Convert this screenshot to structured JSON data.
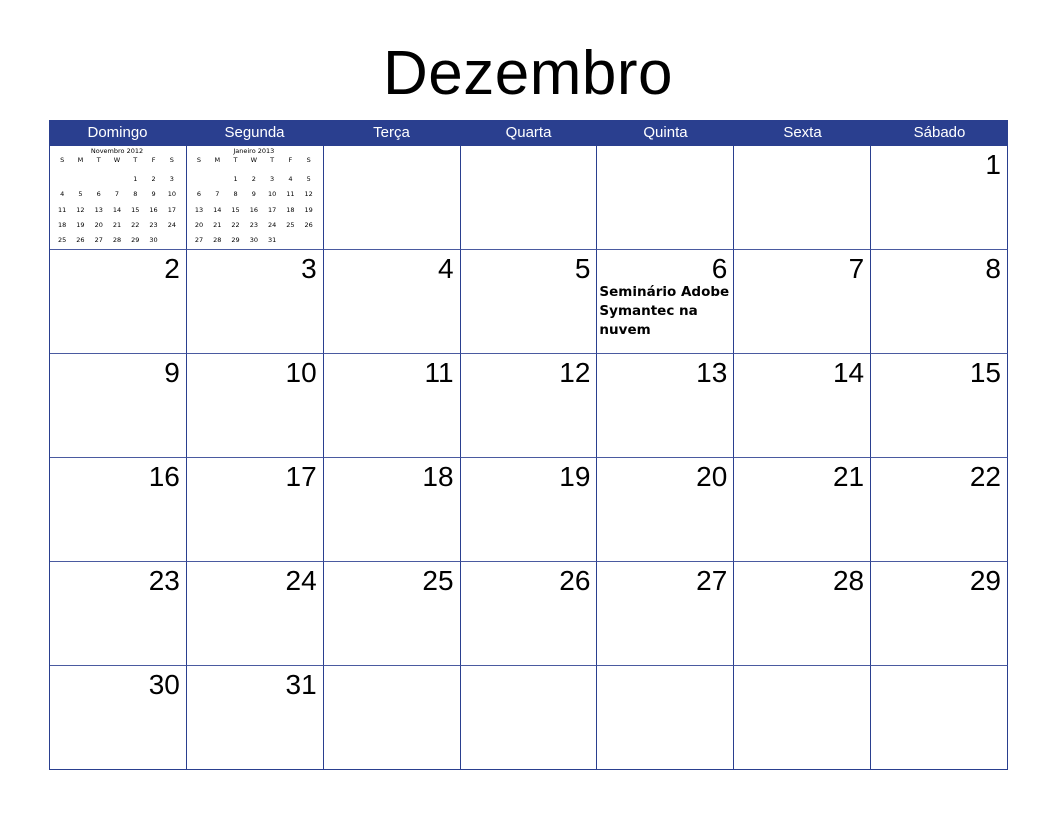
{
  "title": "Dezembro",
  "weekdays": [
    "Domingo",
    "Segunda",
    "Terça",
    "Quarta",
    "Quinta",
    "Sexta",
    "Sábado"
  ],
  "mini_calendars": [
    {
      "title": "Novembro 2012",
      "days_header": [
        "S",
        "M",
        "T",
        "W",
        "T",
        "F",
        "S"
      ],
      "weeks": [
        [
          "",
          "",
          "",
          "",
          "1",
          "2",
          "3"
        ],
        [
          "4",
          "5",
          "6",
          "7",
          "8",
          "9",
          "10"
        ],
        [
          "11",
          "12",
          "13",
          "14",
          "15",
          "16",
          "17"
        ],
        [
          "18",
          "19",
          "20",
          "21",
          "22",
          "23",
          "24"
        ],
        [
          "25",
          "26",
          "27",
          "28",
          "29",
          "30",
          ""
        ]
      ]
    },
    {
      "title": "Janeiro 2013",
      "days_header": [
        "S",
        "M",
        "T",
        "W",
        "T",
        "F",
        "S"
      ],
      "weeks": [
        [
          "",
          "",
          "1",
          "2",
          "3",
          "4",
          "5"
        ],
        [
          "6",
          "7",
          "8",
          "9",
          "10",
          "11",
          "12"
        ],
        [
          "13",
          "14",
          "15",
          "16",
          "17",
          "18",
          "19"
        ],
        [
          "20",
          "21",
          "22",
          "23",
          "24",
          "25",
          "26"
        ],
        [
          "27",
          "28",
          "29",
          "30",
          "31",
          "",
          ""
        ]
      ]
    }
  ],
  "weeks": [
    [
      "",
      "",
      "",
      "",
      "",
      "",
      "1"
    ],
    [
      "2",
      "3",
      "4",
      "5",
      "6",
      "7",
      "8"
    ],
    [
      "9",
      "10",
      "11",
      "12",
      "13",
      "14",
      "15"
    ],
    [
      "16",
      "17",
      "18",
      "19",
      "20",
      "21",
      "22"
    ],
    [
      "23",
      "24",
      "25",
      "26",
      "27",
      "28",
      "29"
    ],
    [
      "30",
      "31",
      "",
      "",
      "",
      "",
      ""
    ]
  ],
  "events": {
    "6": "Seminário Adobe Symantec na nuvem"
  },
  "colors": {
    "header_bg": "#2a3f8f",
    "header_text": "#ffffff",
    "grid_lines": "#2a3f8f"
  }
}
